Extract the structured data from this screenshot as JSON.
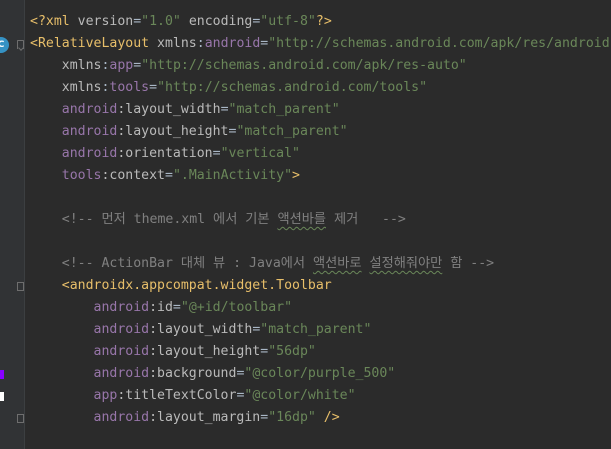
{
  "editor": {
    "language": "xml",
    "gutter": {
      "badge_label": "C"
    },
    "lines": [
      [
        {
          "t": "<?xml ",
          "c": "decl"
        },
        {
          "t": "version",
          "c": "attrname"
        },
        {
          "t": "=",
          "c": "plain"
        },
        {
          "t": "\"1.0\"",
          "c": "val"
        },
        {
          "t": " encoding",
          "c": "attrname"
        },
        {
          "t": "=",
          "c": "plain"
        },
        {
          "t": "\"utf-8\"",
          "c": "val"
        },
        {
          "t": "?>",
          "c": "decl"
        }
      ],
      [
        {
          "t": "<RelativeLayout ",
          "c": "tag"
        },
        {
          "t": "xmlns",
          "c": "attrname"
        },
        {
          "t": ":",
          "c": "plain"
        },
        {
          "t": "android",
          "c": "ns"
        },
        {
          "t": "=",
          "c": "plain"
        },
        {
          "t": "\"http://schemas.android.com/apk/res/android\"",
          "c": "val"
        }
      ],
      [
        {
          "t": "    xmlns",
          "c": "attrname"
        },
        {
          "t": ":",
          "c": "plain"
        },
        {
          "t": "app",
          "c": "ns"
        },
        {
          "t": "=",
          "c": "plain"
        },
        {
          "t": "\"http://schemas.android.com/apk/res-auto\"",
          "c": "val"
        }
      ],
      [
        {
          "t": "    xmlns",
          "c": "attrname"
        },
        {
          "t": ":",
          "c": "plain"
        },
        {
          "t": "tools",
          "c": "ns"
        },
        {
          "t": "=",
          "c": "plain"
        },
        {
          "t": "\"http://schemas.android.com/tools\"",
          "c": "val"
        }
      ],
      [
        {
          "t": "    android",
          "c": "ns"
        },
        {
          "t": ":layout_width",
          "c": "attrname"
        },
        {
          "t": "=",
          "c": "plain"
        },
        {
          "t": "\"match_parent\"",
          "c": "val"
        }
      ],
      [
        {
          "t": "    android",
          "c": "ns"
        },
        {
          "t": ":layout_height",
          "c": "attrname"
        },
        {
          "t": "=",
          "c": "plain"
        },
        {
          "t": "\"match_parent\"",
          "c": "val"
        }
      ],
      [
        {
          "t": "    android",
          "c": "ns"
        },
        {
          "t": ":orientation",
          "c": "attrname"
        },
        {
          "t": "=",
          "c": "plain"
        },
        {
          "t": "\"vertical\"",
          "c": "val"
        }
      ],
      [
        {
          "t": "    tools",
          "c": "ns"
        },
        {
          "t": ":context",
          "c": "attrname"
        },
        {
          "t": "=",
          "c": "plain"
        },
        {
          "t": "\".MainActivity\"",
          "c": "val"
        },
        {
          "t": ">",
          "c": "tag"
        }
      ],
      [],
      [
        {
          "t": "    <!-- 먼저 theme.xml 에서 기본 ",
          "c": "comment"
        },
        {
          "t": "액션바를",
          "c": "comment",
          "typo": true
        },
        {
          "t": " 제거   -->",
          "c": "comment"
        }
      ],
      [],
      [
        {
          "t": "    <!-- ActionBar 대체 뷰 : Java에서 ",
          "c": "comment"
        },
        {
          "t": "액션바로",
          "c": "comment",
          "typo": true
        },
        {
          "t": " ",
          "c": "comment"
        },
        {
          "t": "설정해줘야만",
          "c": "comment",
          "typo": true
        },
        {
          "t": " 함 -->",
          "c": "comment"
        }
      ],
      [
        {
          "t": "    <androidx.appcompat.widget.Toolbar",
          "c": "tag"
        }
      ],
      [
        {
          "t": "        android",
          "c": "ns"
        },
        {
          "t": ":id",
          "c": "attrname"
        },
        {
          "t": "=",
          "c": "plain"
        },
        {
          "t": "\"@+id/toolbar\"",
          "c": "val"
        }
      ],
      [
        {
          "t": "        android",
          "c": "ns"
        },
        {
          "t": ":layout_width",
          "c": "attrname"
        },
        {
          "t": "=",
          "c": "plain"
        },
        {
          "t": "\"match_parent\"",
          "c": "val"
        }
      ],
      [
        {
          "t": "        android",
          "c": "ns"
        },
        {
          "t": ":layout_height",
          "c": "attrname"
        },
        {
          "t": "=",
          "c": "plain"
        },
        {
          "t": "\"56dp\"",
          "c": "val"
        }
      ],
      [
        {
          "t": "        android",
          "c": "ns"
        },
        {
          "t": ":background",
          "c": "attrname"
        },
        {
          "t": "=",
          "c": "plain"
        },
        {
          "t": "\"@color/purple_500\"",
          "c": "val"
        }
      ],
      [
        {
          "t": "        app",
          "c": "ns"
        },
        {
          "t": ":titleTextColor",
          "c": "attrname"
        },
        {
          "t": "=",
          "c": "plain"
        },
        {
          "t": "\"@color/white\"",
          "c": "val"
        }
      ],
      [
        {
          "t": "        android",
          "c": "ns"
        },
        {
          "t": ":layout_margin",
          "c": "attrname"
        },
        {
          "t": "=",
          "c": "plain"
        },
        {
          "t": "\"16dp\"",
          "c": "val"
        },
        {
          "t": " />",
          "c": "tag"
        }
      ]
    ],
    "colors": {
      "background": "#2b2b2b",
      "gutter": "#313335",
      "tag": "#e8bf6a",
      "namespace": "#9876aa",
      "attribute": "#bababa",
      "string": "#6a8759",
      "comment": "#808080",
      "badge": "#3592c4",
      "change_marker_purple": "#8800ff"
    }
  }
}
